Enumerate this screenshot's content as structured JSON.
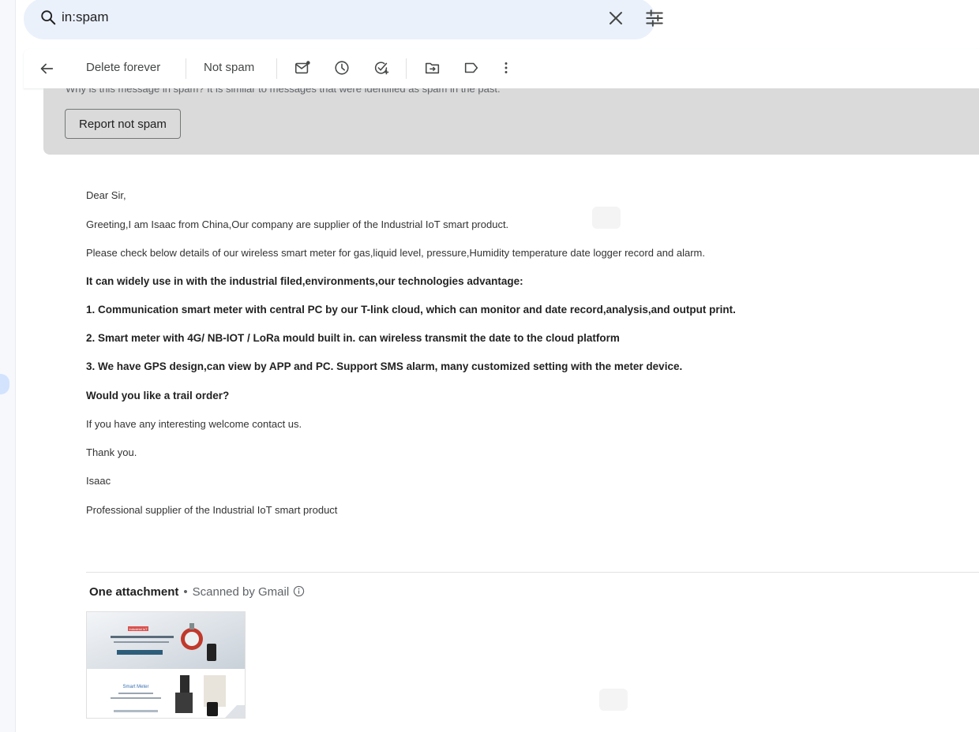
{
  "search": {
    "query": "in:spam",
    "icons": {
      "search": "search-icon",
      "clear": "close-icon",
      "options": "tune-icon"
    }
  },
  "toolbar": {
    "delete_forever": "Delete forever",
    "not_spam": "Not spam",
    "icons": [
      "back-arrow-icon",
      "mark-unread-icon",
      "snooze-clock-icon",
      "add-task-icon",
      "move-to-icon",
      "label-icon",
      "more-vert-icon"
    ]
  },
  "banner": {
    "why_text": "Why is this message in spam? It is similar to messages that were identified as spam in the past.",
    "report_button": "Report not spam",
    "background": "#dadada"
  },
  "email": {
    "lines": [
      {
        "text": "Dear Sir,",
        "bold": false
      },
      {
        "text": "Greeting,I am Isaac from China,Our company are supplier of the Industrial IoT smart product.",
        "bold": false
      },
      {
        "text": "Please check below details of our wireless smart meter for gas,liquid level, pressure,Humidity temperature date logger record and alarm.",
        "bold": false
      },
      {
        "text": "It can widely use in with the industrial filed,environments,our technologies advantage:",
        "bold": true
      },
      {
        "text": "1. Communication smart meter with central PC by our T-link cloud, which can monitor and date record,analysis,and output print.",
        "bold": true
      },
      {
        "text": "2. Smart meter with 4G/ NB-IOT / LoRa mould built in. can wireless transmit the date to the cloud platform",
        "bold": true
      },
      {
        "text": "3. We have GPS design,can view by APP and PC. Support SMS alarm, many customized setting with the meter device.",
        "bold": true
      },
      {
        "text": "Would you like a trail order?",
        "bold": true
      },
      {
        "text": "If you have any interesting welcome contact us.",
        "bold": false
      },
      {
        "text": "Thank you.",
        "bold": false
      },
      {
        "text": "Isaac",
        "bold": false
      },
      {
        "text": "Professional  supplier of the Industrial IoT smart product",
        "bold": false
      }
    ]
  },
  "attachments": {
    "title": "One attachment",
    "separator": "•",
    "scan_text": "Scanned by Gmail",
    "thumbnail": {
      "banner_label": "Smart Meter",
      "top_badge": "Industrial IoT"
    }
  }
}
